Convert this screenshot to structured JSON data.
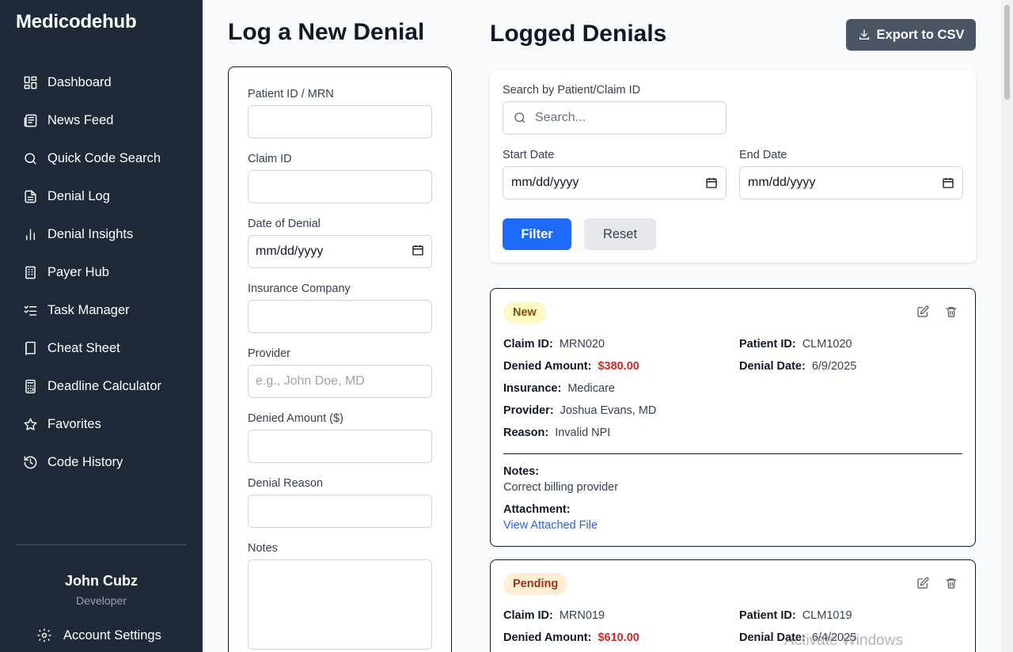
{
  "brand": "Medicodehub",
  "nav": [
    {
      "label": "Dashboard",
      "icon": "dashboard-icon"
    },
    {
      "label": "News Feed",
      "icon": "newspaper-icon"
    },
    {
      "label": "Quick Code Search",
      "icon": "search-icon"
    },
    {
      "label": "Denial Log",
      "icon": "document-icon"
    },
    {
      "label": "Denial Insights",
      "icon": "bar-chart-icon"
    },
    {
      "label": "Payer Hub",
      "icon": "building-icon"
    },
    {
      "label": "Task Manager",
      "icon": "checklist-icon"
    },
    {
      "label": "Cheat Sheet",
      "icon": "book-icon"
    },
    {
      "label": "Deadline Calculator",
      "icon": "calculator-icon"
    },
    {
      "label": "Favorites",
      "icon": "star-icon"
    },
    {
      "label": "Code History",
      "icon": "history-icon"
    }
  ],
  "user": {
    "name": "John Cubz",
    "role": "Developer"
  },
  "account_settings": "Account Settings",
  "form": {
    "title": "Log a New Denial",
    "patient_label": "Patient ID / MRN",
    "claim_label": "Claim ID",
    "date_label": "Date of Denial",
    "date_placeholder": "mm/dd/yyyy",
    "insurance_label": "Insurance Company",
    "provider_label": "Provider",
    "provider_placeholder": "e.g., John Doe, MD",
    "amount_label": "Denied Amount ($)",
    "reason_label": "Denial Reason",
    "notes_label": "Notes"
  },
  "list": {
    "title": "Logged Denials",
    "export_label": "Export to CSV",
    "search_label": "Search by Patient/Claim ID",
    "search_placeholder": "Search...",
    "start_label": "Start Date",
    "end_label": "End Date",
    "start_value": "mm/dd/yyyy",
    "end_value": "mm/dd/yyyy",
    "filter_label": "Filter",
    "reset_label": "Reset"
  },
  "denials": [
    {
      "status": "New",
      "claim_label": "Claim ID:",
      "claim": "MRN020",
      "patient_label": "Patient ID:",
      "patient": "CLM1020",
      "amount_label": "Denied Amount:",
      "amount": "$380.00",
      "date_label": "Denial Date:",
      "date": "6/9/2025",
      "insurance_label": "Insurance:",
      "insurance": "Medicare",
      "provider_label": "Provider:",
      "provider": "Joshua Evans, MD",
      "reason_label": "Reason:",
      "reason": "Invalid NPI",
      "notes_label": "Notes:",
      "notes": "Correct billing provider",
      "attachment_label": "Attachment:",
      "attachment_link": "View Attached File"
    },
    {
      "status": "Pending",
      "claim_label": "Claim ID:",
      "claim": "MRN019",
      "patient_label": "Patient ID:",
      "patient": "CLM1019",
      "amount_label": "Denied Amount:",
      "amount": "$610.00",
      "date_label": "Denial Date:",
      "date": "6/4/2025"
    }
  ],
  "watermark": "Activate Windows"
}
